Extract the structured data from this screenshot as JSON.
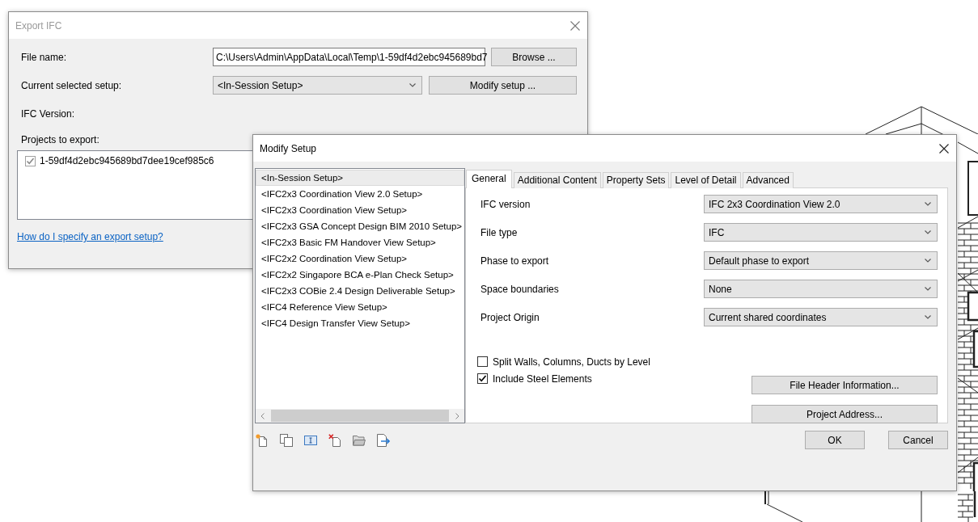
{
  "export_dialog": {
    "title": "Export IFC",
    "active": false,
    "file_name": {
      "label": "File name:",
      "value": "C:\\Users\\Admin\\AppData\\Local\\Temp\\1-59df4d2ebc945689bd7",
      "button": "Browse ..."
    },
    "setup": {
      "label": "Current selected setup:",
      "value": "<In-Session Setup>",
      "button": "Modify setup ..."
    },
    "ifc_version": {
      "label": "IFC Version:"
    },
    "projects": {
      "label": "Projects to export:",
      "items": [
        {
          "name": "1-59df4d2ebc945689bd7dee19cef985c6",
          "checked": true,
          "disabled": true
        }
      ]
    },
    "help_link": "How do I specify an export setup?"
  },
  "modify_dialog": {
    "title": "Modify Setup",
    "active": true,
    "setups": [
      {
        "name": "<In-Session Setup>",
        "selected": true
      },
      {
        "name": "<IFC2x3 Coordination View 2.0 Setup>",
        "selected": false
      },
      {
        "name": "<IFC2x3 Coordination View Setup>",
        "selected": false
      },
      {
        "name": "<IFC2x3 GSA Concept Design BIM 2010 Setup>",
        "selected": false
      },
      {
        "name": "<IFC2x3 Basic FM Handover View Setup>",
        "selected": false
      },
      {
        "name": "<IFC2x2 Coordination View Setup>",
        "selected": false
      },
      {
        "name": "<IFC2x2 Singapore BCA e-Plan Check Setup>",
        "selected": false
      },
      {
        "name": "<IFC2x3 COBie 2.4 Design Deliverable Setup>",
        "selected": false
      },
      {
        "name": "<IFC4 Reference View Setup>",
        "selected": false
      },
      {
        "name": "<IFC4 Design Transfer View Setup>",
        "selected": false
      }
    ],
    "tabs": [
      {
        "label": "General",
        "selected": true
      },
      {
        "label": "Additional Content",
        "selected": false
      },
      {
        "label": "Property Sets",
        "selected": false
      },
      {
        "label": "Level of Detail",
        "selected": false
      },
      {
        "label": "Advanced",
        "selected": false
      }
    ],
    "fields": [
      {
        "label": "IFC version",
        "value": "IFC 2x3 Coordination View 2.0"
      },
      {
        "label": "File type",
        "value": "IFC"
      },
      {
        "label": "Phase to export",
        "value": "Default phase to export"
      },
      {
        "label": "Space boundaries",
        "value": "None"
      },
      {
        "label": "Project Origin",
        "value": "Current shared coordinates"
      }
    ],
    "options": [
      {
        "label": "Split Walls, Columns, Ducts by Level",
        "checked": false
      },
      {
        "label": "Include Steel Elements",
        "checked": true
      }
    ],
    "side_buttons": [
      "File Header Information...",
      "Project Address..."
    ],
    "buttons": [
      "OK",
      "Cancel"
    ]
  }
}
